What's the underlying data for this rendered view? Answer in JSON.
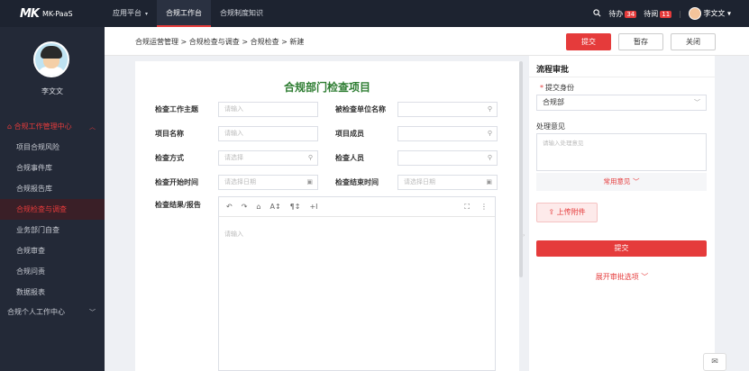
{
  "app": {
    "logo_mark": "MK",
    "logo_text": "MK-PaaS"
  },
  "topnav": [
    {
      "label": "应用平台",
      "caret": "▾"
    },
    {
      "label": "合规工作台"
    },
    {
      "label": "合规制度知识"
    }
  ],
  "top_right": {
    "todo_label": "待办",
    "todo_count": "34",
    "read_label": "待阅",
    "read_count": "11",
    "user": "李文文"
  },
  "sidebar": {
    "username": "李文文",
    "group_label": "合规工作管理中心",
    "items": [
      "项目合规风险",
      "合规事件库",
      "合规报告库",
      "合规检查与调查",
      "业务部门自查",
      "合规审查",
      "合规问责",
      "数据报表"
    ],
    "group2_label": "合规个人工作中心"
  },
  "breadcrumb": "合规运营管理 > 合规检查与调查 > 合规检查 > 新建",
  "header_buttons": {
    "submit": "提交",
    "save": "暂存",
    "close": "关闭"
  },
  "form": {
    "title": "合规部门检查项目",
    "labels": {
      "topic": "检查工作主题",
      "target_unit": "被检查单位名称",
      "project_name": "项目名称",
      "members": "项目成员",
      "method": "检查方式",
      "inspector": "检查人员",
      "start_time": "检查开始时间",
      "end_time": "检查结束时间",
      "result": "检查结果/报告"
    },
    "placeholders": {
      "input": "请输入",
      "select": "请选择",
      "date": "请选择日期"
    },
    "editor_placeholder": "请输入"
  },
  "approval": {
    "title": "流程审批",
    "identity_label": "提交身份",
    "identity_value": "合规部",
    "opinion_label": "处理意见",
    "opinion_placeholder": "请输入处理意见",
    "common_opinion": "常用意见",
    "upload": "上传附件",
    "submit": "提交",
    "expand": "展开审批选项"
  }
}
